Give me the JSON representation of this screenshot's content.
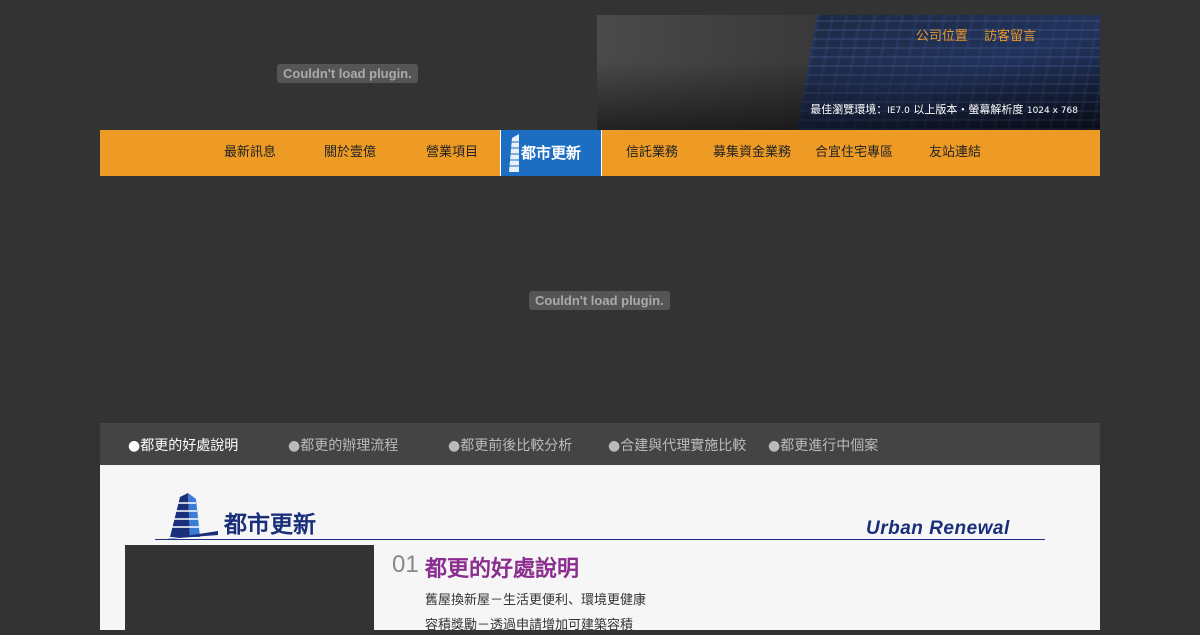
{
  "plugin": {
    "message": "Couldn't load plugin."
  },
  "header": {
    "links": [
      "公司位置",
      "訪客留言"
    ],
    "browse_note_text": "最佳瀏覽環境：",
    "browse_note_ie": "IE7.0",
    "browse_note_mid": " 以上版本・螢幕解析度 ",
    "browse_note_res": "1024 x 768"
  },
  "nav": {
    "items": [
      "最新訊息",
      "關於壹億",
      "營業項目",
      "都市更新",
      "信託業務",
      "募集資金業務",
      "合宜住宅專區",
      "友站連結"
    ],
    "active": "都市更新"
  },
  "subnav": {
    "items": [
      "●都更的好處說明",
      "●都更的辦理流程",
      "●都更前後比較分析",
      "●合建與代理實施比較",
      "●都更進行中個案"
    ],
    "active_index": 0
  },
  "content": {
    "title_zh": "都市更新",
    "title_en": "Urban Renewal",
    "section_number": "01",
    "section_title": "都更的好處說明",
    "lines": [
      "舊屋換新屋－生活更便利、環境更健康",
      "容積獎勵－透過申請增加可建築容積"
    ]
  },
  "colors": {
    "nav_bg": "#ee9b26",
    "nav_active": "#1b6ec2",
    "link_orange": "#e89a2c",
    "title_purple": "#8b2d8f",
    "brand_blue": "#1a2f7a"
  }
}
